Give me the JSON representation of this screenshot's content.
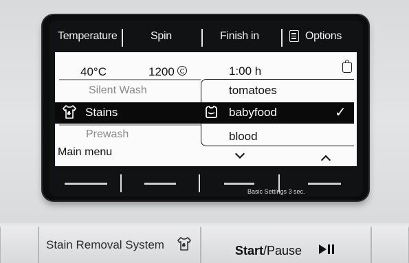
{
  "topbar": {
    "temperature": "Temperature",
    "spin": "Spin",
    "finish_in": "Finish in",
    "options": "Options"
  },
  "status": {
    "temperature": "40°C",
    "spin": "1200",
    "finish_time": "1:00 h"
  },
  "programs": {
    "above": "Silent Wash",
    "selected": "Stains",
    "below": "Prewash"
  },
  "stain_types": {
    "above": "tomatoes",
    "selected": "babyfood",
    "below": "blood",
    "selected_mark": "✓"
  },
  "main_menu": "Main menu",
  "softkeys": {
    "hint": "Basic Settings 3 sec."
  },
  "buttons": {
    "stain_removal": "Stain Removal System",
    "start": "Start",
    "pause": "/Pause"
  },
  "icons": {
    "spin": "spin-icon",
    "options": "list-icon",
    "stains": "shirt-stain-icon",
    "babyfood": "bib-icon",
    "start_pause": "play-pause-icon"
  }
}
